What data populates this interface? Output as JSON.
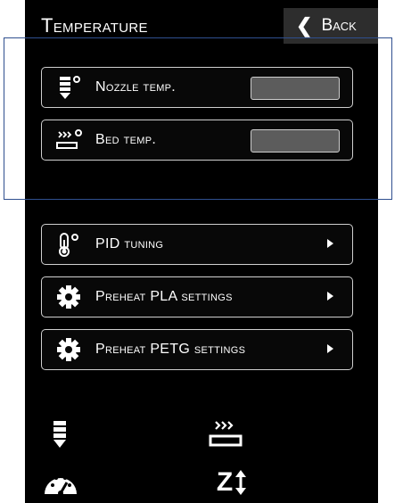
{
  "header": {
    "title": "Temperature",
    "back_label": "Back"
  },
  "temperature_rows": [
    {
      "label": "Nozzle temp.",
      "icon": "nozzle-icon",
      "value": ""
    },
    {
      "label": "Bed temp.",
      "icon": "heated-bed-icon",
      "value": ""
    }
  ],
  "menu_rows": [
    {
      "label": "PID tuning",
      "icon": "thermometer-icon"
    },
    {
      "label": "Preheat PLA settings",
      "icon": "gear-icon"
    },
    {
      "label": "Preheat PETG settings",
      "icon": "gear-icon"
    }
  ],
  "status_bar": {
    "icons": [
      "nozzle-icon",
      "heated-bed-icon",
      "speed-gauge-icon",
      "z-axis-icon"
    ],
    "z_label": "Z"
  },
  "colors": {
    "screen_background": "#000000",
    "header_button": "#2d2d2d",
    "input_field": "#5c5c5c",
    "border": "#cfcfcf",
    "highlight_frame": "#2f4f8f"
  }
}
